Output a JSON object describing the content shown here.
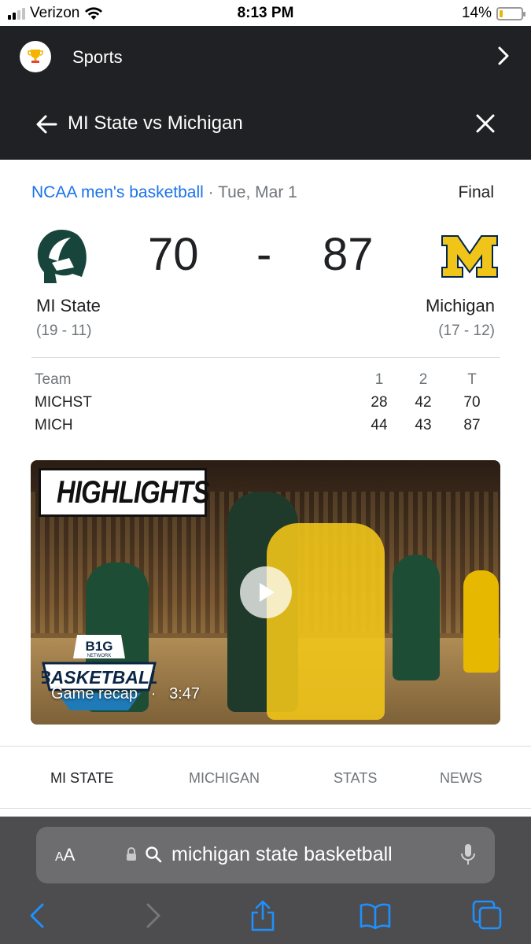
{
  "status_bar": {
    "carrier": "Verizon",
    "time": "8:13 PM",
    "battery": "14%",
    "battery_level": 0.14
  },
  "sports_header": {
    "title": "Sports",
    "icon": "trophy-icon"
  },
  "matchup_header": {
    "title": "MI State vs Michigan"
  },
  "game": {
    "league": "NCAA men's basketball",
    "date_sep": " · ",
    "date": "Tue, Mar 1",
    "status": "Final",
    "score_dash": "-",
    "home": {
      "name": "MI State",
      "record": "(19 - 11)",
      "score": "70",
      "abbr": "MICHST"
    },
    "away": {
      "name": "Michigan",
      "record": "(17 - 12)",
      "score": "87",
      "abbr": "MICH"
    }
  },
  "linescore": {
    "headers": [
      "Team",
      "1",
      "2",
      "T"
    ],
    "rows": [
      {
        "team": "MICHST",
        "q1": "28",
        "q2": "42",
        "t": "70"
      },
      {
        "team": "MICH",
        "q1": "44",
        "q2": "43",
        "t": "87"
      }
    ]
  },
  "video": {
    "badge": "HIGHLIGHTS",
    "network_logo_top": "B1G",
    "network_logo_mid": "NETWORK",
    "network_logo_bottom": "BASKETBALL",
    "caption": "Game recap",
    "caption_sep": "·",
    "duration": "3:47"
  },
  "tabs": [
    {
      "label": "MI STATE",
      "active": true
    },
    {
      "label": "MICHIGAN",
      "active": false
    },
    {
      "label": "STATS",
      "active": false
    },
    {
      "label": "NEWS",
      "active": false
    }
  ],
  "safari": {
    "aa_small": "A",
    "aa_large": "A",
    "query": "michigan state basketball"
  },
  "colors": {
    "accent": "#1a73e8",
    "header_bg": "#202124",
    "michigan_maize": "#f0c419",
    "msu_green": "#18453b"
  }
}
